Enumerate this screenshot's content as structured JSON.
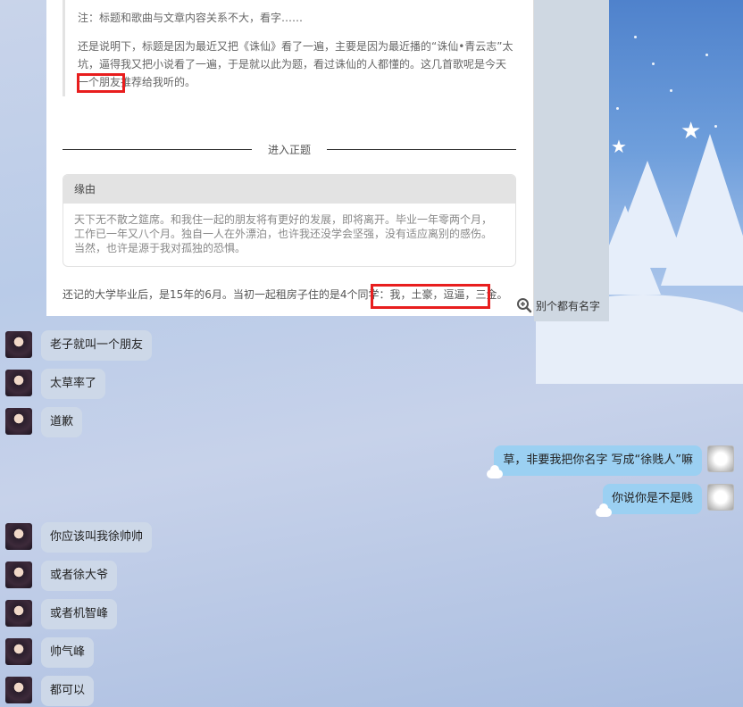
{
  "screenshot": {
    "quote_para1": "注：标题和歌曲与文章内容关系不大，看字……",
    "quote_para2": "还是说明下，标题是因为最近又把《诛仙》看了一遍，主要是因为最近播的“诛仙•青云志”太坑，逼得我又把小说看了一遍，于是就以此为题，看过诛仙的人都懂的。这几首歌呢是今天一个朋友推荐给我听的。",
    "divider_label": "进入正题",
    "panel_title": "缘由",
    "panel_body": "天下无不散之筵席。和我住一起的朋友将有更好的发展，即将离开。毕业一年零两个月，工作已一年又八个月。独自一人在外漂泊，也许我还没学会坚强，没有适应离别的感伤。当然，也许是源于我对孤独的恐惧。",
    "bottom_line": "还记的大学毕业后，是15年的6月。当初一起租房子住的是4个同学：我，土豪，逗逼，三金。"
  },
  "overlay_text": "别个都有名字",
  "messages": [
    {
      "side": "in",
      "text": "老子就叫一个朋友"
    },
    {
      "side": "in",
      "text": "太草率了"
    },
    {
      "side": "in",
      "text": "道歉"
    },
    {
      "side": "out",
      "text": "草，非要我把你名字 写成“徐贱人”嘛"
    },
    {
      "side": "out",
      "text": "你说你是不是贱"
    },
    {
      "side": "in",
      "text": "你应该叫我徐帅帅"
    },
    {
      "side": "in",
      "text": "或者徐大爷"
    },
    {
      "side": "in",
      "text": "或者机智峰"
    },
    {
      "side": "in",
      "text": "帅气峰"
    },
    {
      "side": "in",
      "text": "都可以"
    }
  ],
  "icons": {
    "zoom": "zoom-in-icon",
    "avatar_left": "avatar-friend",
    "avatar_right": "avatar-self"
  },
  "colors": {
    "highlight_box": "#e81e1e",
    "bubble_in": "#cdd8e8",
    "bubble_out": "#9bd0f2"
  }
}
